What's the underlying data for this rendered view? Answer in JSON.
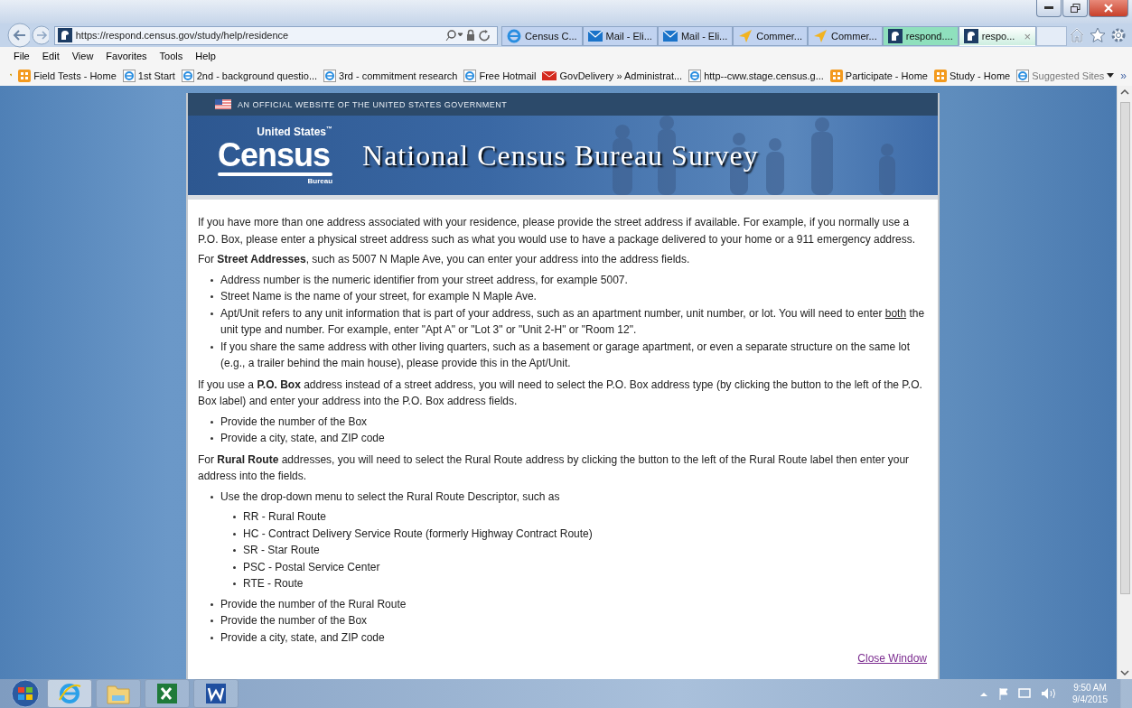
{
  "browser": {
    "address": "https://respond.census.gov/study/help/residence",
    "tabs": [
      {
        "label": "Census C...",
        "kind": "ie",
        "selected": false
      },
      {
        "label": "Mail - Eli...",
        "kind": "mail",
        "selected": false
      },
      {
        "label": "Mail - Eli...",
        "kind": "mail",
        "selected": false
      },
      {
        "label": "Commer...",
        "kind": "arrow",
        "selected": false
      },
      {
        "label": "Commer...",
        "kind": "arrow",
        "selected": false
      },
      {
        "label": "respond....",
        "kind": "site",
        "selected": false
      },
      {
        "label": "respo...",
        "kind": "site",
        "selected": true,
        "close": "×"
      }
    ],
    "menu": [
      "File",
      "Edit",
      "View",
      "Favorites",
      "Tools",
      "Help"
    ],
    "favorites": [
      {
        "label": "Field Tests - Home",
        "kind": "grid"
      },
      {
        "label": "1st Start",
        "kind": "ie"
      },
      {
        "label": "2nd - background questio...",
        "kind": "ie"
      },
      {
        "label": "3rd - commitment research",
        "kind": "ie"
      },
      {
        "label": "Free Hotmail",
        "kind": "ie"
      },
      {
        "label": "GovDelivery » Administrat...",
        "kind": "mail"
      },
      {
        "label": "http--cww.stage.census.g...",
        "kind": "ie"
      },
      {
        "label": "Participate - Home",
        "kind": "grid"
      },
      {
        "label": "Study - Home",
        "kind": "grid"
      },
      {
        "label": "Suggested Sites",
        "kind": "suggested"
      }
    ],
    "more": "»"
  },
  "site": {
    "banner": "AN OFFICIAL WEBSITE OF THE UNITED STATES GOVERNMENT",
    "logo_top": "United States",
    "logo_mark": "™",
    "logo_main": "Census",
    "logo_bottom": "Bureau",
    "title": "National Census Bureau Survey"
  },
  "content": [
    {
      "kind": "para",
      "text": "If you have more than one address associated with your residence, please provide the street address if available. For example, if you normally use a P.O. Box, please enter a physical street address such as what you would use to have a package delivered to your home or a 911 emergency address."
    },
    {
      "kind": "para",
      "text": "For **Street Addresses**, such as 5007 N Maple Ave, you can enter your address into the address fields."
    },
    {
      "kind": "list",
      "items": [
        {
          "text": "Address number is the numeric identifier from your street address, for example 5007."
        },
        {
          "text": "Street Name is the name of your street, for example N Maple Ave."
        },
        {
          "text": "Apt/Unit refers to any unit information that is part of your address, such as an apartment number, unit number, or lot. You will need to enter ",
          "underlined": "both",
          "text_after": " the unit type and number. For example, enter \"Apt A\" or \"Lot 3\" or \"Unit 2-H\" or \"Room 12\"."
        },
        {
          "text": "If you share the same address with other living quarters, such as a basement or garage apartment, or even a separate structure on the same lot (e.g., a trailer behind the main house), please provide this in the Apt/Unit."
        }
      ]
    },
    {
      "kind": "para",
      "text": "If you use a **P.O. Box** address instead of a street address, you will need to select the P.O. Box address type (by clicking the button to the left of the P.O. Box label) and enter your address into the P.O. Box address fields."
    },
    {
      "kind": "list",
      "items": [
        {
          "text": "Provide the number of the Box"
        },
        {
          "text": "Provide a city, state, and ZIP code"
        }
      ]
    },
    {
      "kind": "para",
      "text": "For **Rural Route** addresses, you will need to select the Rural Route address by clicking the button to the left of the Rural Route label then enter your address into the fields."
    },
    {
      "kind": "list",
      "items": [
        {
          "text": "Use the drop-down menu to select the Rural Route Descriptor, such as",
          "children": [
            {
              "text": "RR - Rural Route"
            },
            {
              "text": "HC - Contract Delivery Service Route (formerly Highway Contract Route)"
            },
            {
              "text": "SR - Star Route"
            },
            {
              "text": "PSC - Postal Service Center"
            },
            {
              "text": "RTE - Route"
            }
          ]
        },
        {
          "text": "Provide the number of the Rural Route"
        },
        {
          "text": "Provide the number of the Box"
        },
        {
          "text": "Provide a city, state, and ZIP code"
        }
      ]
    }
  ],
  "close_link": "Close Window",
  "taskbar": {
    "time": "9:50 AM",
    "date": "9/4/2015"
  }
}
